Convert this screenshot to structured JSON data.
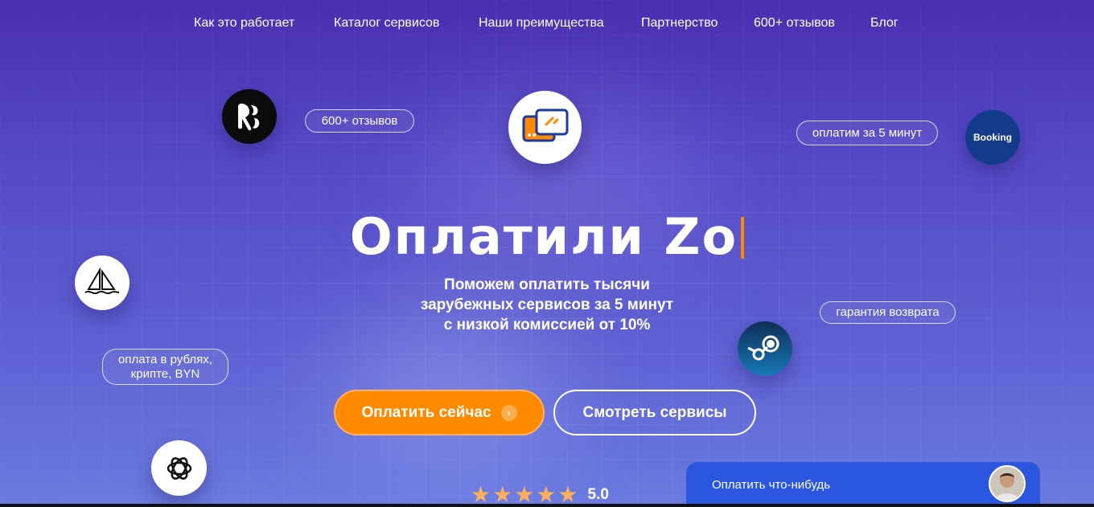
{
  "nav": {
    "items": [
      {
        "label": "Как это работает"
      },
      {
        "label": "Каталог сервисов"
      },
      {
        "label": "Наши преимущества"
      },
      {
        "label": "Партнерство"
      },
      {
        "label": "600+ отзывов"
      },
      {
        "label": "Блог"
      }
    ]
  },
  "floating": {
    "reviews_pill": "600+ отзывов",
    "pay5_pill": "оплатим за 5 минут",
    "refund_pill": "гарантия возврата",
    "currency_pill_line1": "оплата в рублях,",
    "currency_pill_line2": "крипте, BYN",
    "booking_label": "Booking"
  },
  "icons": [
    "klarna-icon",
    "card-logo-icon",
    "booking-icon",
    "midjourney-icon",
    "steam-icon",
    "openai-icon"
  ],
  "hero": {
    "title": "Оплатили Zo",
    "subtitle_line1": "Поможем оплатить тысячи",
    "subtitle_line2": "зарубежных сервисов за 5 минут",
    "subtitle_line3": "с низкой комиссией от 10%"
  },
  "buttons": {
    "pay_now": "Оплатить сейчас",
    "view_services": "Смотреть сервисы"
  },
  "rating": {
    "stars": "★★★★★",
    "value": "5.0"
  },
  "chat": {
    "label": "Оплатить что-нибудь"
  },
  "colors": {
    "accent": "#ff8a00",
    "background_top": "#4a2fb0",
    "background_bottom": "#6b7be0",
    "chat": "#2a56e0"
  }
}
